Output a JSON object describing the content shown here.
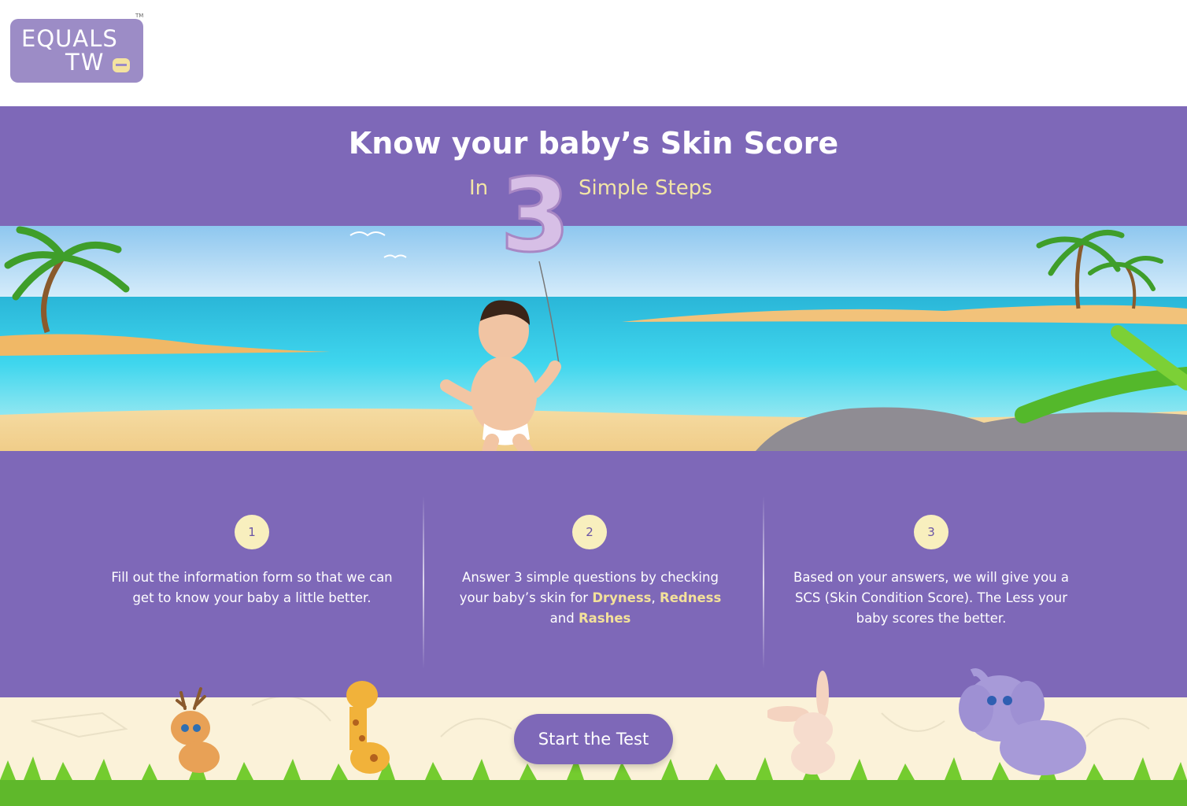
{
  "brand": {
    "logo_line1": "EQUALS",
    "logo_line2": "TW",
    "trademark": "TM"
  },
  "hero": {
    "title_prefix": "Know your baby’s ",
    "title_bold": "Skin Score",
    "subtitle_in": "In",
    "balloon_number": "3",
    "subtitle_steps": "Simple Steps"
  },
  "steps": [
    {
      "number": "1",
      "text": "Fill out the information form so that we can get to know your baby a little better."
    },
    {
      "number": "2",
      "text_before": "Answer 3 simple questions by checking your baby’s skin for ",
      "hl1": "Dryness",
      "sep1": ",",
      "hl2": "Redness",
      "sep2": " and ",
      "hl3": "Rashes"
    },
    {
      "number": "3",
      "text": "Based on your answers, we will give you a SCS (Skin Condition Score). The Less your baby scores the better."
    }
  ],
  "cta": {
    "label": "Start the Test"
  },
  "colors": {
    "purple": "#7e68b8",
    "cream": "#f3e6a6",
    "logo_bg": "#9c8cc6",
    "footer_bg": "#fbf2d9"
  },
  "icons": [
    "palm-tree-icon",
    "baby-illustration",
    "number-three-balloon-icon",
    "deer-illustration",
    "giraffe-illustration",
    "bunny-illustration",
    "elephant-illustration"
  ]
}
